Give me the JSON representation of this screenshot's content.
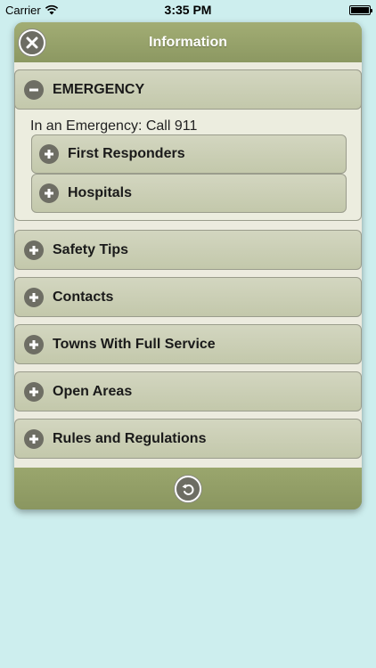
{
  "status_bar": {
    "carrier": "Carrier",
    "time": "3:35 PM"
  },
  "header": {
    "title": "Information"
  },
  "emergency": {
    "label": "EMERGENCY",
    "text": "In an Emergency: Call 911",
    "sub_items": [
      {
        "label": "First Responders"
      },
      {
        "label": "Hospitals"
      }
    ]
  },
  "sections": [
    {
      "label": "Safety Tips"
    },
    {
      "label": "Contacts"
    },
    {
      "label": "Towns With Full Service"
    },
    {
      "label": "Open Areas"
    },
    {
      "label": "Rules and Regulations"
    }
  ],
  "colors": {
    "background": "#cdeeee",
    "header": "#97a36a",
    "body": "#ecebdf",
    "section": "#c8ccb1",
    "icon": "#6e6e64"
  },
  "icons": {
    "close": "close-icon",
    "minus": "minus-icon",
    "plus": "plus-icon",
    "undo": "undo-icon"
  }
}
